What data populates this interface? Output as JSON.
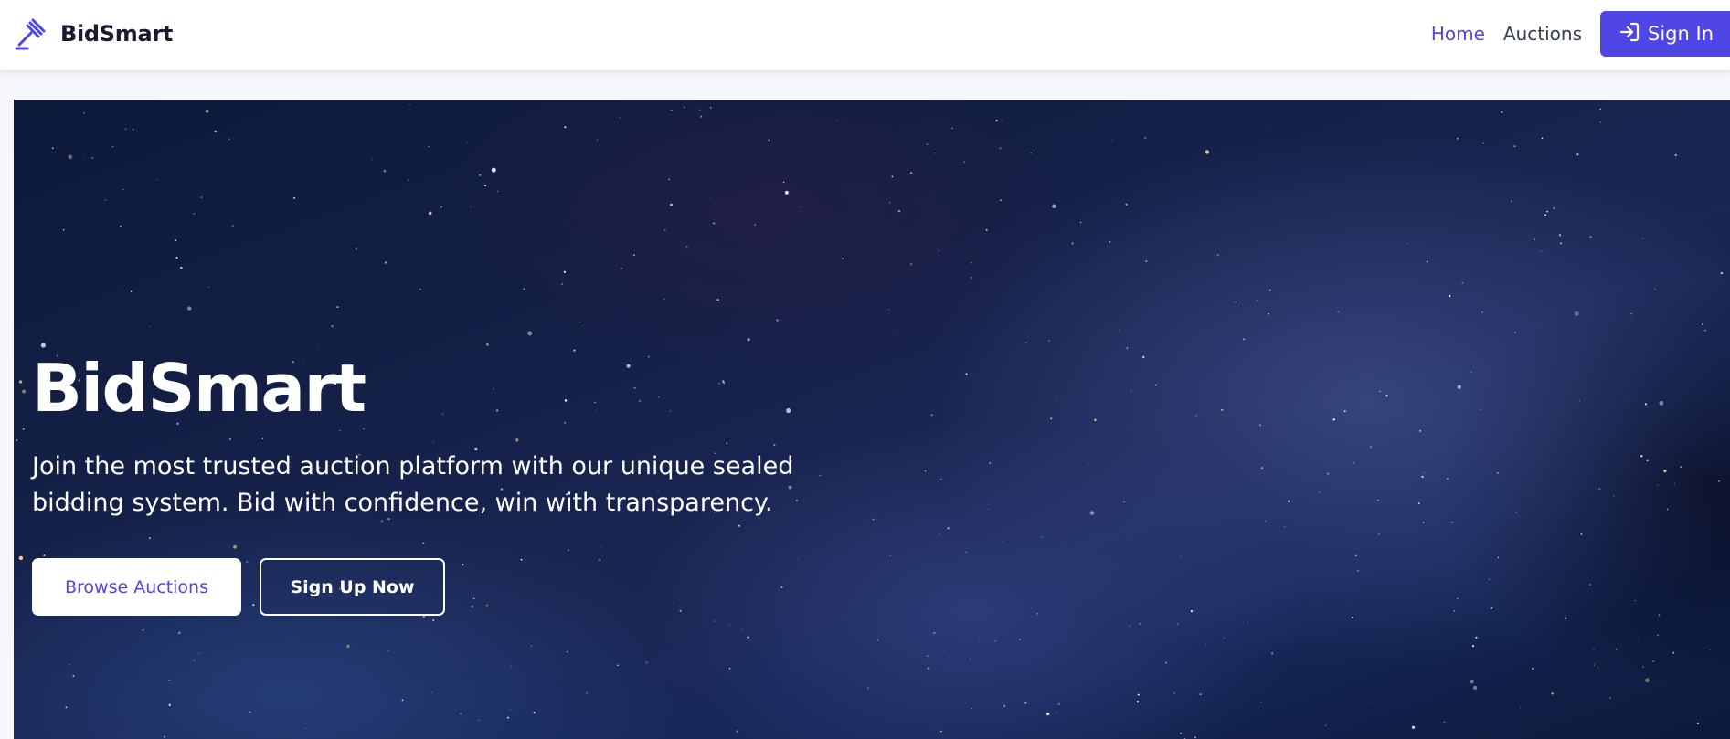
{
  "navbar": {
    "brand": {
      "icon": "gavel-icon",
      "name": "BidSmart"
    },
    "links": [
      {
        "label": "Home",
        "active": true
      },
      {
        "label": "Auctions",
        "active": false
      }
    ],
    "signin": {
      "icon": "sign-in-icon",
      "label": "Sign In"
    }
  },
  "hero": {
    "background": "starry-space-nebula",
    "title": "BidSmart",
    "subtitle": "Join the most trusted auction platform with our unique sealed bidding system. Bid with confidence, win with transparency.",
    "primary_button": "Browse Auctions",
    "secondary_button": "Sign Up Now"
  },
  "colors": {
    "accent": "#4f46e5",
    "nav_text": "#374151",
    "brand_text": "#1b1b2e",
    "hero_text": "#ffffff"
  }
}
